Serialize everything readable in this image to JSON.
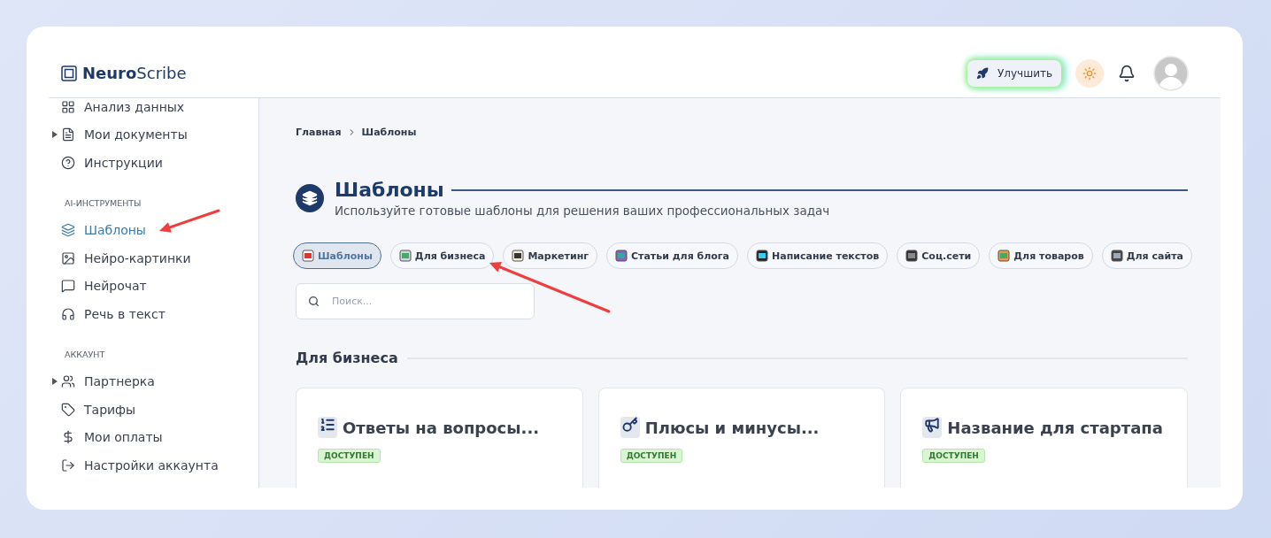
{
  "header": {
    "logo": "**Neuro**Scribe",
    "upgrade_button": "Улучшить"
  },
  "sidebar": {
    "sections": [
      {
        "items": [
          {
            "label": "Анализ данных",
            "kind": "link",
            "selected": false
          },
          {
            "label": "Мои документы",
            "kind": "group",
            "expanded": false,
            "selected": false
          },
          {
            "label": "Инструкции",
            "kind": "link",
            "selected": false
          }
        ]
      },
      {
        "title": "AI-ИНСТРУМЕНТЫ",
        "items": [
          {
            "label": "Шаблоны",
            "kind": "link",
            "selected": true
          },
          {
            "label": "Нейро-картинки",
            "kind": "link",
            "selected": false
          },
          {
            "label": "Нейрочат",
            "kind": "link",
            "selected": false
          },
          {
            "label": "Речь в текст",
            "kind": "link",
            "selected": false
          }
        ]
      },
      {
        "title": "АККАУНТ",
        "items": [
          {
            "label": "Партнерка",
            "kind": "group",
            "expanded": false,
            "selected": false
          },
          {
            "label": "Тарифы",
            "kind": "link",
            "selected": false
          },
          {
            "label": "Мои оплаты",
            "kind": "link",
            "selected": false
          },
          {
            "label": "Настройки аккаунта",
            "kind": "link",
            "selected": false
          }
        ]
      }
    ]
  },
  "breadcrumb": [
    "Главная",
    "Шаблоны"
  ],
  "page": {
    "title": "Шаблоны",
    "subtitle": "Используйте готовые шаблоны для решения ваших профессиональных задач"
  },
  "filters": [
    {
      "label": "Шаблоны",
      "selected": true
    },
    {
      "label": "Для бизнеса",
      "selected": false
    },
    {
      "label": "Маркетинг",
      "selected": false
    },
    {
      "label": "Статьи для блога",
      "selected": false
    },
    {
      "label": "Написание текстов",
      "selected": false
    },
    {
      "label": "Соц.сети",
      "selected": false
    },
    {
      "label": "Для товаров",
      "selected": false
    },
    {
      "label": "Для сайта",
      "selected": false
    }
  ],
  "search": {
    "placeholder": "Поиск..."
  },
  "section": {
    "title": "Для бизнеса",
    "cards": [
      {
        "title": "Ответы на вопросы...",
        "badge": "ДОСТУПЕН"
      },
      {
        "title": "Плюсы и минусы...",
        "badge": "ДОСТУПЕН"
      },
      {
        "title": "Название для стартапа",
        "badge": "ДОСТУПЕН"
      }
    ]
  }
}
